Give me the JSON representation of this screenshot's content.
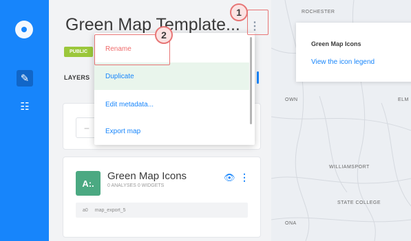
{
  "editor": {
    "title": "Green Map Template...",
    "privacy_badge": "PUBLIC",
    "tab_layers": "LAYERS"
  },
  "layer": {
    "icon_letters": "A:.",
    "name": "Green Map Icons",
    "meta": "0 ANALYSES 0 WIDGETS",
    "source_id": "a0",
    "source_name": "map_export_5",
    "color": "#4ba982"
  },
  "menu": {
    "items": [
      "Rename",
      "Duplicate",
      "Edit metadata...",
      "Export map"
    ]
  },
  "map": {
    "cities": [
      "ROCHESTER",
      "OWN",
      "ELM",
      "WILLIAMSPORT",
      "STATE COLLEGE",
      "ONA"
    ],
    "legend_title": "Green Map Icons",
    "legend_link": "View the icon legend"
  },
  "annotations": {
    "marker1": "1",
    "marker2": "2"
  },
  "colors": {
    "accent": "#1785fb",
    "highlight": "#e77575",
    "badge": "#9bc73b"
  }
}
